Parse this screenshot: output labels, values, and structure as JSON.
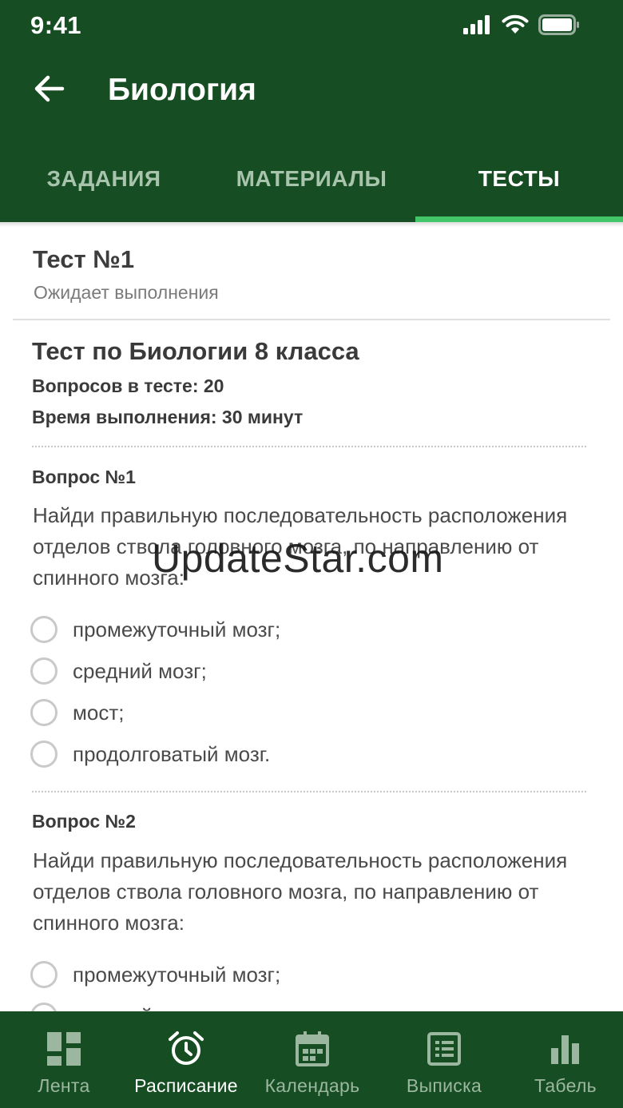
{
  "status_bar": {
    "time": "9:41"
  },
  "appbar": {
    "title": "Биология"
  },
  "tabs": [
    {
      "label": "ЗАДАНИЯ",
      "active": false
    },
    {
      "label": "МАТЕРИАЛЫ",
      "active": false
    },
    {
      "label": "ТЕСТЫ",
      "active": true
    }
  ],
  "test_header": {
    "title": "Тест №1",
    "status": "Ожидает выполнения"
  },
  "test_info": {
    "title": "Тест по Биологии 8 класса",
    "questions_count": "Вопросов в тесте: 20",
    "duration": "Время выполнения: 30 минут"
  },
  "questions": [
    {
      "label": "Вопрос №1",
      "text": "Найди правильную последовательность расположения отделов ствола головного мозга, по направлению от спинного мозга:",
      "options": [
        "промежуточный мозг;",
        "средний мозг;",
        "мост;",
        "продолговатый мозг."
      ]
    },
    {
      "label": "Вопрос №2",
      "text": "Найди правильную последовательность расположения отделов ствола головного мозга, по направлению от спинного мозга:",
      "options": [
        "промежуточный мозг;",
        "средний мозг;"
      ]
    }
  ],
  "watermark": "UpdateStar.com",
  "bottom_nav": [
    {
      "label": "Лента",
      "icon": "dashboard-icon",
      "active": false
    },
    {
      "label": "Расписание",
      "icon": "alarm-clock-icon",
      "active": true
    },
    {
      "label": "Календарь",
      "icon": "calendar-icon",
      "active": false
    },
    {
      "label": "Выписка",
      "icon": "list-document-icon",
      "active": false
    },
    {
      "label": "Табель",
      "icon": "bar-chart-icon",
      "active": false
    }
  ],
  "colors": {
    "header_bg": "#174d22",
    "tab_indicator": "#43c56a",
    "tab_inactive": "#a9c4ad",
    "nav_inactive": "#9bb7a0"
  }
}
